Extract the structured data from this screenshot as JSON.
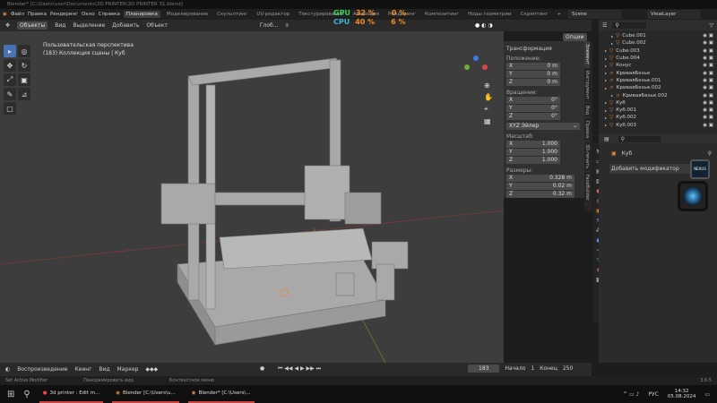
{
  "window_title": "Blender* [C:\\Users\\user\\Documents\\3D PRINTER\\3D PRINTER 31.blend]",
  "menu": [
    "Файл",
    "Правка",
    "Рендеринг",
    "Окно",
    "Справка"
  ],
  "workspaces": [
    {
      "label": "Планировка",
      "active": true
    },
    {
      "label": "Моделирование"
    },
    {
      "label": "Скульптинг"
    },
    {
      "label": "UV-редактор"
    },
    {
      "label": "Текстурирование"
    },
    {
      "label": "Анимация"
    },
    {
      "label": "Рендеринг"
    },
    {
      "label": "Композитинг"
    },
    {
      "label": "Ноды геометрии"
    },
    {
      "label": "Скриптинг"
    },
    {
      "label": "+"
    }
  ],
  "overlay_stats": {
    "gpu_label": "GPU",
    "cpu_label": "CPU",
    "gpu_pct": "32 %",
    "cpu_pct": "40 %",
    "gpu2": "0 %",
    "cpu2": "6 %",
    "color_gpu": "#39d353",
    "color_pct": "#f08a24"
  },
  "scene": "Scene",
  "view_layer": "ViewLayer",
  "viewport_header": {
    "mode": "Объекты",
    "menus": [
      "Вид",
      "Выделение",
      "Добавить",
      "Объект"
    ],
    "orientation": "Глоб...",
    "options": "Опции"
  },
  "viewport": {
    "perspective": "Пользовательская перспектива",
    "collection": "(183) Коллекция сцены | Куб"
  },
  "npanel": {
    "title": "Трансформация",
    "location_label": "Положение:",
    "location": [
      {
        "axis": "X",
        "value": "0 m"
      },
      {
        "axis": "Y",
        "value": "0 m"
      },
      {
        "axis": "Z",
        "value": "0 m"
      }
    ],
    "rotation_label": "Вращение:",
    "rotation": [
      {
        "axis": "X",
        "value": "0°"
      },
      {
        "axis": "Y",
        "value": "0°"
      },
      {
        "axis": "Z",
        "value": "0°"
      }
    ],
    "rotation_mode": "XYZ Эйлер",
    "scale_label": "Масштаб:",
    "scale": [
      {
        "axis": "X",
        "value": "1.000"
      },
      {
        "axis": "Y",
        "value": "1.000"
      },
      {
        "axis": "Z",
        "value": "1.000"
      }
    ],
    "dimensions_label": "Размеры:",
    "dimensions": [
      {
        "axis": "X",
        "value": "0.328 m"
      },
      {
        "axis": "Y",
        "value": "0.02 m"
      },
      {
        "axis": "Z",
        "value": "0.32 m"
      }
    ]
  },
  "side_tabs": [
    "Элемент",
    "Инструмент",
    "Вид",
    "Правка",
    "3D-печать",
    "FaceBuilder"
  ],
  "outliner": [
    {
      "name": "Cube.001",
      "indent": 2
    },
    {
      "name": "Cube.002",
      "indent": 2
    },
    {
      "name": "Cube.003",
      "indent": 1
    },
    {
      "name": "Cube.004",
      "indent": 1
    },
    {
      "name": "Конус",
      "indent": 1
    },
    {
      "name": "КриваяБезье",
      "indent": 1
    },
    {
      "name": "КриваяБезье.001",
      "indent": 1
    },
    {
      "name": "КриваяБезье.002",
      "indent": 1
    },
    {
      "name": "КриваяБезье.002",
      "indent": 2
    },
    {
      "name": "Куб",
      "indent": 1
    },
    {
      "name": "Куб.001",
      "indent": 1
    },
    {
      "name": "Куб.002",
      "indent": 1
    },
    {
      "name": "Куб.003",
      "indent": 1
    }
  ],
  "properties": {
    "object": "Куб",
    "add_modifier": "Добавить модификатор",
    "camera_widget": "NEXUS"
  },
  "timeline": {
    "menus": [
      "Воспроизведение",
      "Кеинг",
      "Вид",
      "Маркер"
    ],
    "current_frame": "183",
    "start_label": "Начало",
    "start": "1",
    "end_label": "Конец",
    "end": "250"
  },
  "status": {
    "items": [
      "Set Active Modifier",
      "Панорамировать вид",
      "Контекстное меню"
    ],
    "version": "3.6.5"
  },
  "taskbar": {
    "apps": [
      "3d printer : Edit m...",
      "Blender [C:\\Users\\u...",
      "Blender* [C:\\Users\\..."
    ],
    "lang": "РУС",
    "time": "14:32",
    "date": "05.08.2024"
  }
}
